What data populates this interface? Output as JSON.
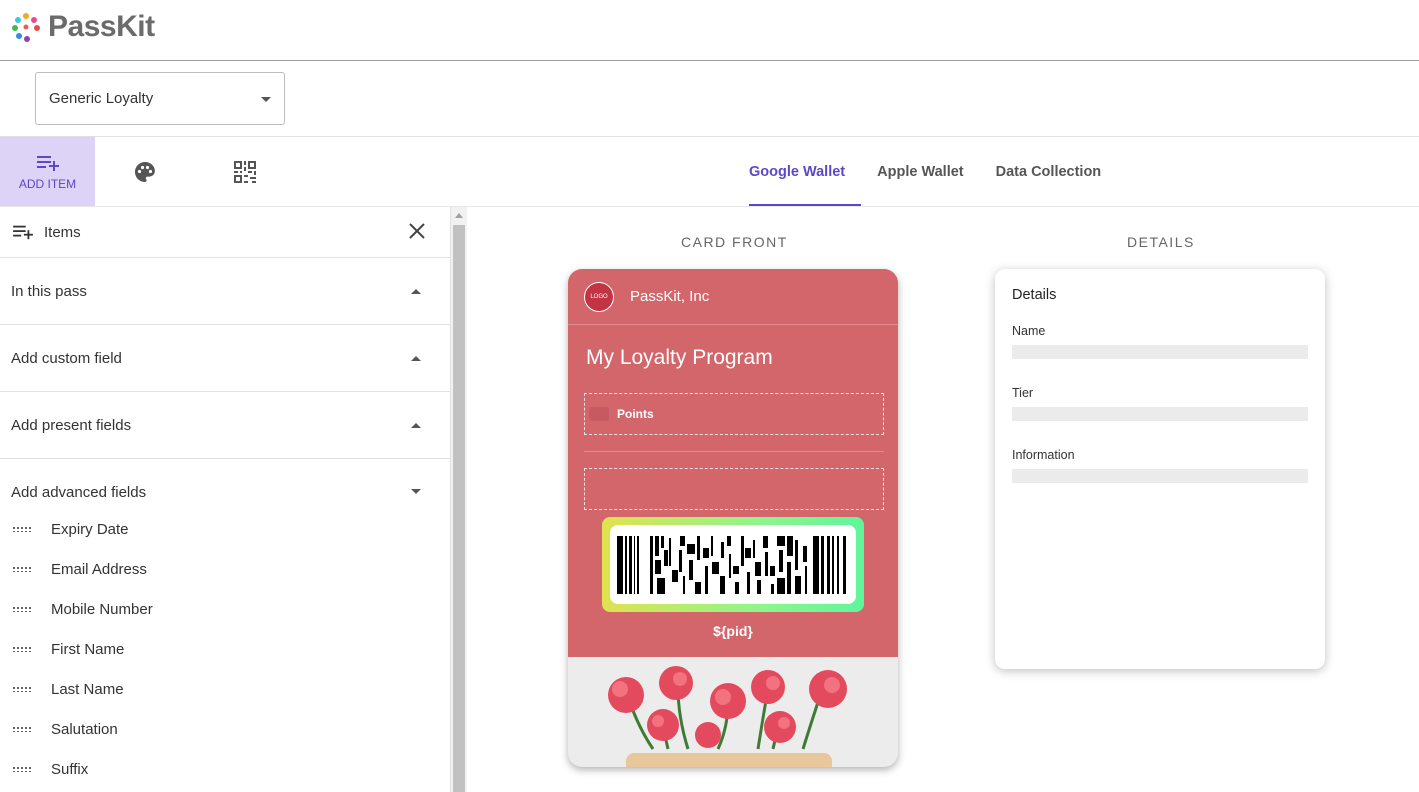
{
  "app": {
    "name": "PassKit"
  },
  "template_select": {
    "value": "Generic Loyalty"
  },
  "toolbar": {
    "add_item_label": "ADD ITEM"
  },
  "tabs": [
    {
      "label": "Google Wallet",
      "active": true
    },
    {
      "label": "Apple Wallet",
      "active": false
    },
    {
      "label": "Data Collection",
      "active": false
    }
  ],
  "panel": {
    "title": "Items",
    "sections": [
      {
        "label": "In this pass",
        "state": "collapsed"
      },
      {
        "label": "Add custom field",
        "state": "collapsed"
      },
      {
        "label": "Add present fields",
        "state": "collapsed"
      },
      {
        "label": "Add advanced fields",
        "state": "expanded"
      }
    ],
    "advanced_fields": [
      "Expiry Date",
      "Email Address",
      "Mobile Number",
      "First Name",
      "Last Name",
      "Salutation",
      "Suffix"
    ]
  },
  "preview": {
    "front_title": "CARD FRONT",
    "details_title": "DETAILS",
    "card": {
      "logo_text": "LOGO",
      "company": "PassKit, Inc",
      "program": "My Loyalty Program",
      "points_label": "Points",
      "pid": "${pid}",
      "color": "#d2666a"
    },
    "details": {
      "heading": "Details",
      "fields": [
        "Name",
        "Tier",
        "Information"
      ]
    }
  },
  "colors": {
    "accent": "#5b48c8",
    "active_tool_bg": "#dcd3f7"
  }
}
